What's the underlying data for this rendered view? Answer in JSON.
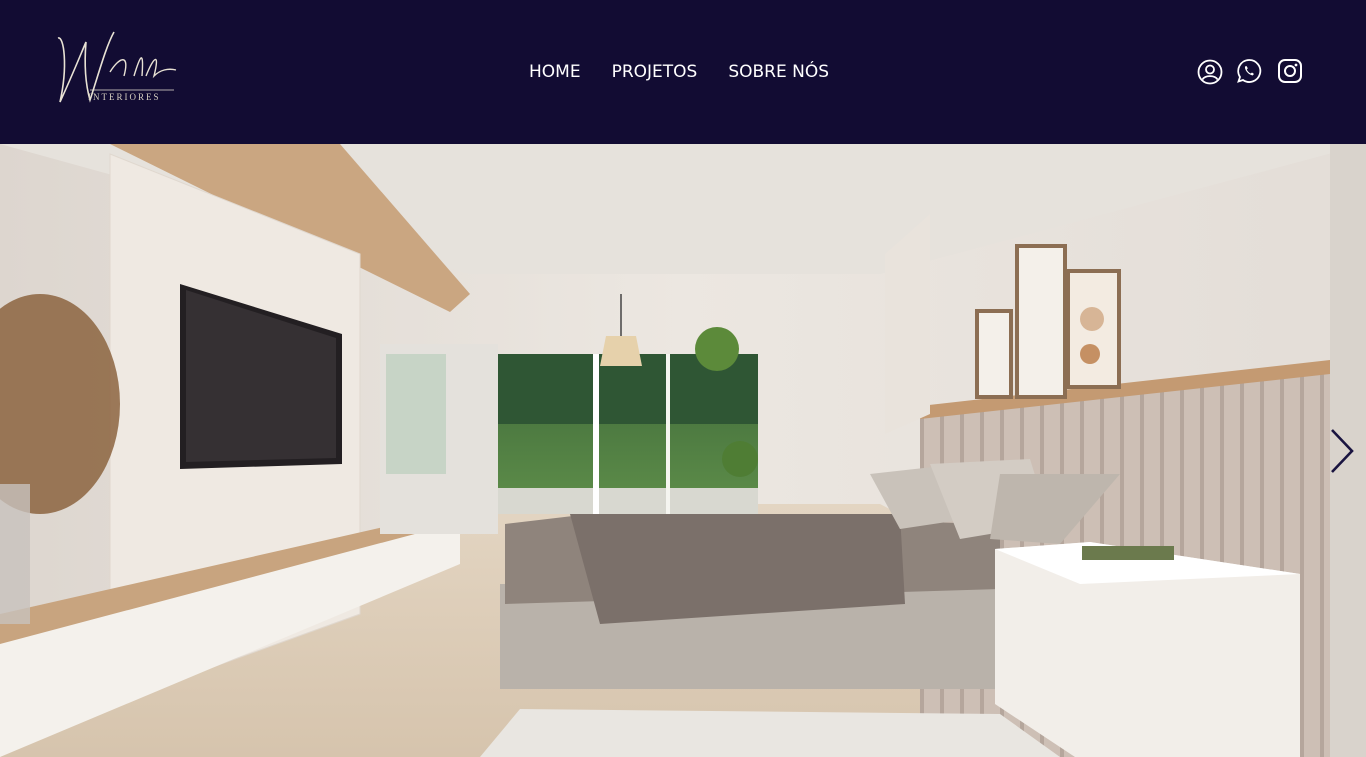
{
  "brand": {
    "logo_script": "Wheller",
    "logo_sub": "INTERIORES"
  },
  "nav": {
    "items": [
      {
        "label": "HOME"
      },
      {
        "label": "PROJETOS"
      },
      {
        "label": "SOBRE NÓS"
      }
    ]
  },
  "social": {
    "icons": [
      "user-icon",
      "whatsapp-icon",
      "instagram-icon"
    ]
  },
  "hero": {
    "carousel_next_icon": "chevron-right-icon",
    "scene": "bedroom-render"
  },
  "colors": {
    "header_bg": "#120c33",
    "nav_text": "#ffffff",
    "logo": "#e8e2d4",
    "arrow": "#1a1440"
  }
}
